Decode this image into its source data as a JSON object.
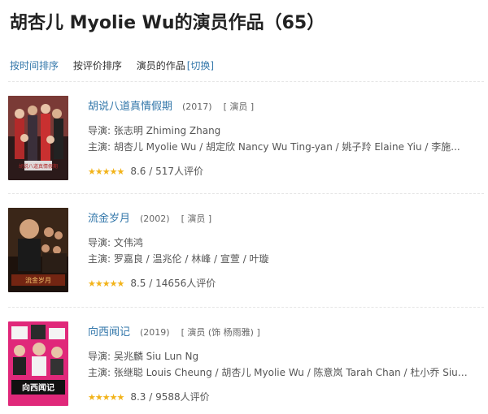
{
  "page": {
    "title": "胡杏儿 Myolie Wu的演员作品（65）"
  },
  "tabs": {
    "by_time": "按时间排序",
    "by_rating": "按评价排序",
    "actor_works": "演员的作品",
    "switch": "[切换]"
  },
  "works": [
    {
      "title": "胡说八道真情假期",
      "year": "(2017)",
      "role": "[ 演员 ]",
      "director": "导演: 张志明 Zhiming Zhang",
      "cast": "主演: 胡杏儿 Myolie Wu / 胡定欣 Nancy Wu Ting-yan / 姚子羚 Elaine Yiu / 李施...",
      "rating": "8.6",
      "votes": "/ 517人评价",
      "stars": "★★★★★",
      "poster_text": "胡说八道\n真情假期"
    },
    {
      "title": "流金岁月",
      "year": "(2002)",
      "role": "[ 演员 ]",
      "director": "导演: 文伟鸿",
      "cast": "主演: 罗嘉良 / 温兆伦 / 林峰 / 宣萱 / 叶璇",
      "rating": "8.5",
      "votes": "/ 14656人评价",
      "stars": "★★★★★",
      "poster_text": "流金岁月"
    },
    {
      "title": "向西闻记",
      "year": "(2019)",
      "role": "[ 演员 (饰 杨雨雅) ]",
      "director": "导演: 吴兆麟 Siu Lun Ng",
      "cast": "主演: 张继聪 Louis Cheung / 胡杏儿 Myolie Wu / 陈意岚 Tarah Chan / 杜小乔 Siu-...",
      "rating": "8.3",
      "votes": "/ 9588人评价",
      "stars": "★★★★★",
      "poster_text": "向西闻记"
    }
  ],
  "colors": {
    "link": "#3377aa",
    "star": "#f2b31a",
    "text": "#333333"
  }
}
